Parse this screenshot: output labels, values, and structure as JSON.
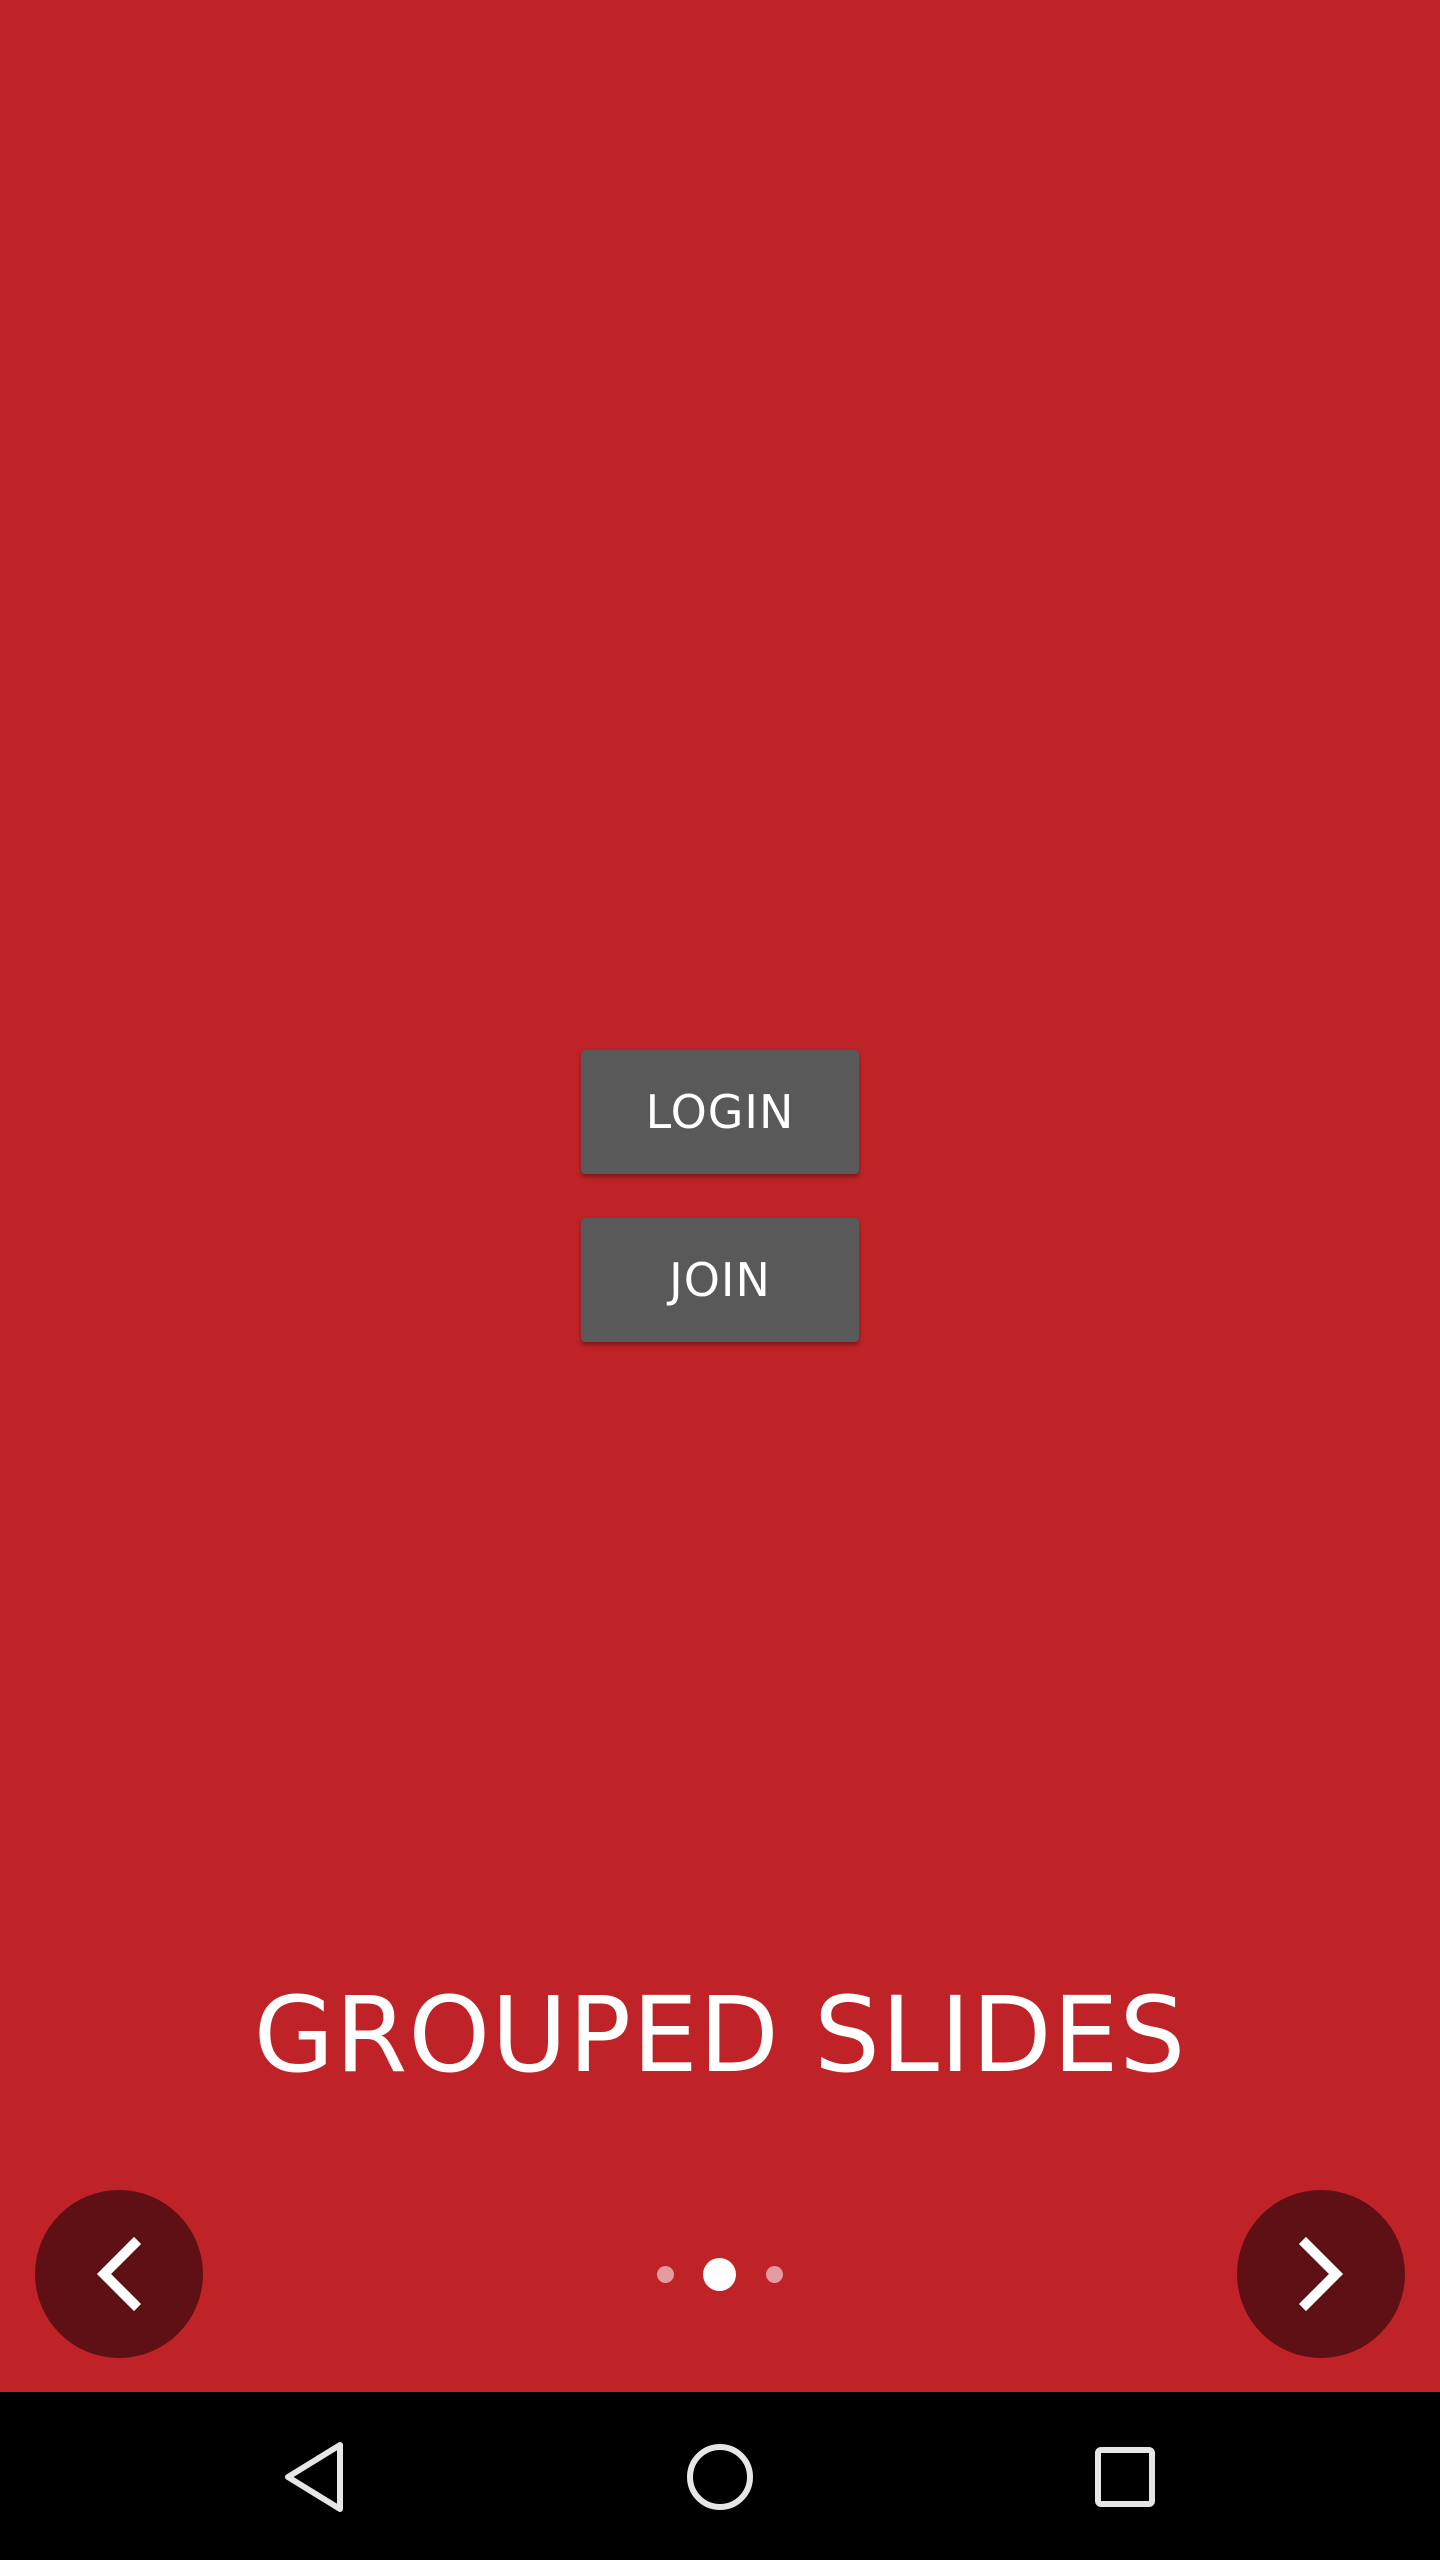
{
  "screen": {
    "background": "#bf2328",
    "buttons": {
      "login_label": "LOGIN",
      "join_label": "JOIN"
    },
    "title": "GROUPED SLIDES",
    "pager": {
      "total_pages": 3,
      "current_page": 2
    },
    "icons": {
      "prev": "chevron-left-icon",
      "next": "chevron-right-icon"
    }
  },
  "system_nav": {
    "icons": [
      "back-triangle-icon",
      "home-circle-icon",
      "recents-square-icon"
    ]
  }
}
